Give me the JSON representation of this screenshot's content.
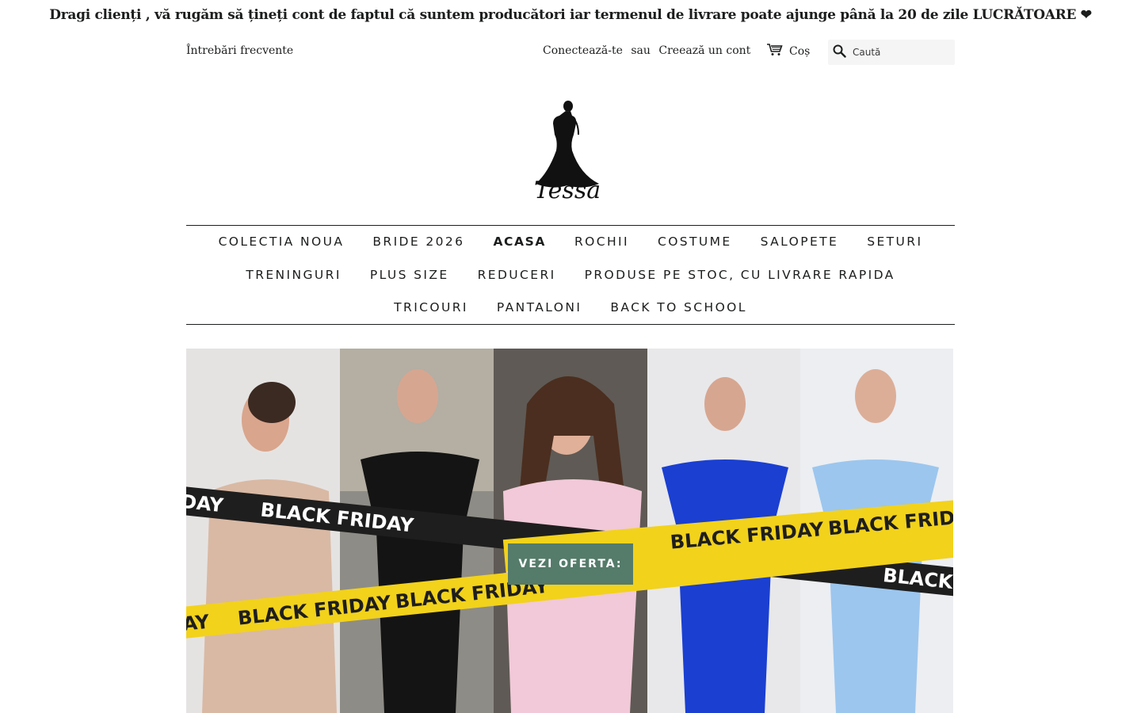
{
  "announcement": "Dragi clienți , vă rugăm să țineți cont de faptul că suntem producători iar termenul de livrare poate ajunge până la 20 de zile LUCRĂTOARE ❤",
  "header": {
    "faq_link": "Întrebări frecvente",
    "login_link": "Conectează-te",
    "or_text": "sau",
    "register_link": "Creează un cont",
    "cart_label": "Coș",
    "cart_icon": "cart-icon",
    "search_icon": "search-icon",
    "search_placeholder": "Caută"
  },
  "logo": {
    "text": "Tessa",
    "icon": "dress-silhouette-logo"
  },
  "nav": {
    "row1": [
      {
        "label": "COLECTIA NOUA"
      },
      {
        "label": "BRIDE 2026"
      },
      {
        "label": "ACASA",
        "active": true
      },
      {
        "label": "ROCHII"
      },
      {
        "label": "COSTUME"
      },
      {
        "label": "SALOPETE"
      },
      {
        "label": "SETURI"
      }
    ],
    "row2": [
      {
        "label": "TRENINGURI"
      },
      {
        "label": "PLUS SIZE"
      },
      {
        "label": "REDUCERI"
      },
      {
        "label": "PRODUSE PE STOC, CU LIVRARE RAPIDA"
      }
    ],
    "row3": [
      {
        "label": "TRICOURI"
      },
      {
        "label": "PANTALONI"
      },
      {
        "label": "BACK TO SCHOOL"
      }
    ]
  },
  "hero": {
    "tape_text": "BLACK FRIDAY",
    "cta_label": "VEZI OFERTA:",
    "colors": {
      "accent": "#557b6a",
      "tape_yellow": "#f2d21b",
      "tape_black": "#1e1e1e",
      "dress_nude": "#d9b9a4",
      "dress_black": "#141414",
      "dress_pink": "#f1c9d8",
      "dress_royal": "#1a3fd1",
      "dress_sky": "#9cc6ee"
    }
  }
}
